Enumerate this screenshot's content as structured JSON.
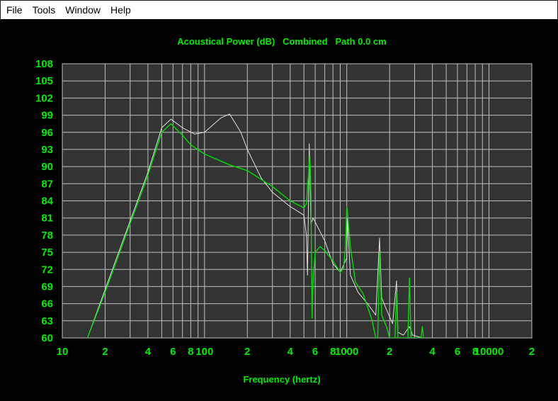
{
  "menu": {
    "items": [
      "File",
      "Tools",
      "Window",
      "Help"
    ]
  },
  "colors": {
    "background": "#000000",
    "plot_background": "#333333",
    "grid": "#bfbfbf",
    "text": "#00ee00",
    "primary_trace": "#00dd00",
    "secondary_trace": "#e0e0e0"
  },
  "chart_data": {
    "type": "line",
    "title": "Acoustical Power (dB)   Combined   Path 0.0 cm",
    "xlabel": "Frequency (hertz)",
    "ylabel": "",
    "x_scale": "log",
    "xlim": [
      10,
      20000
    ],
    "ylim": [
      60,
      108
    ],
    "grid": true,
    "y_ticks": [
      60,
      63,
      66,
      69,
      72,
      75,
      78,
      81,
      84,
      87,
      90,
      93,
      96,
      99,
      102,
      105,
      108
    ],
    "y_tick_labels": [
      "60",
      "63",
      "66",
      "69",
      "72",
      "75",
      "78",
      "81",
      "84",
      "87",
      "90",
      "93",
      "96",
      "99",
      "102",
      "105",
      "108"
    ],
    "x_ticks": [
      10,
      20,
      40,
      60,
      80,
      100,
      200,
      400,
      600,
      800,
      1000,
      2000,
      4000,
      6000,
      8000,
      10000,
      20000
    ],
    "x_tick_labels": [
      "10",
      "2",
      "4",
      "6",
      "8",
      "100",
      "2",
      "4",
      "6",
      "8",
      "1000",
      "2",
      "4",
      "6",
      "8",
      "10000",
      "2"
    ],
    "series": [
      {
        "color": "#00dd00",
        "points": [
          [
            15,
            60
          ],
          [
            20,
            68
          ],
          [
            30,
            80
          ],
          [
            40,
            88.5
          ],
          [
            50,
            96
          ],
          [
            58,
            97.5
          ],
          [
            70,
            95.5
          ],
          [
            80,
            93.8
          ],
          [
            100,
            92.2
          ],
          [
            150,
            90.3
          ],
          [
            200,
            89.3
          ],
          [
            300,
            86.5
          ],
          [
            400,
            84
          ],
          [
            500,
            82.8
          ],
          [
            520,
            83.5
          ],
          [
            540,
            89
          ],
          [
            550,
            92
          ],
          [
            560,
            85
          ],
          [
            570,
            63.5
          ],
          [
            580,
            70
          ],
          [
            600,
            75
          ],
          [
            650,
            76
          ],
          [
            700,
            75.3
          ],
          [
            800,
            73.5
          ],
          [
            900,
            71.5
          ],
          [
            950,
            72.2
          ],
          [
            980,
            76
          ],
          [
            1000,
            83
          ],
          [
            1020,
            81
          ],
          [
            1060,
            76
          ],
          [
            1150,
            69.8
          ],
          [
            1300,
            67.8
          ],
          [
            1500,
            63.2
          ],
          [
            1600,
            60
          ],
          [
            1650,
            60
          ],
          [
            1700,
            75
          ],
          [
            1760,
            64
          ],
          [
            1900,
            62
          ],
          [
            2000,
            60
          ],
          [
            2180,
            60
          ],
          [
            2240,
            68
          ],
          [
            2290,
            60
          ],
          [
            2690,
            60
          ],
          [
            2760,
            70.5
          ],
          [
            2830,
            60
          ],
          [
            3330,
            60
          ],
          [
            3400,
            62
          ],
          [
            3470,
            60
          ]
        ]
      },
      {
        "color": "#e0e0e0",
        "points": [
          [
            15,
            60
          ],
          [
            20,
            68.5
          ],
          [
            30,
            80.5
          ],
          [
            40,
            89
          ],
          [
            50,
            96.8
          ],
          [
            58,
            98.3
          ],
          [
            70,
            96.8
          ],
          [
            85,
            95.7
          ],
          [
            100,
            96
          ],
          [
            130,
            98.5
          ],
          [
            150,
            99.2
          ],
          [
            180,
            96
          ],
          [
            200,
            93
          ],
          [
            250,
            88
          ],
          [
            300,
            85.5
          ],
          [
            400,
            83
          ],
          [
            500,
            81.5
          ],
          [
            520,
            78
          ],
          [
            530,
            71
          ],
          [
            545,
            94
          ],
          [
            560,
            80
          ],
          [
            580,
            81
          ],
          [
            700,
            77
          ],
          [
            800,
            73
          ],
          [
            900,
            71.5
          ],
          [
            1000,
            74
          ],
          [
            1010,
            81
          ],
          [
            1060,
            71
          ],
          [
            1200,
            68
          ],
          [
            1400,
            66
          ],
          [
            1600,
            64
          ],
          [
            1700,
            77.5
          ],
          [
            1760,
            67
          ],
          [
            1900,
            65
          ],
          [
            2100,
            62.5
          ],
          [
            2240,
            70
          ],
          [
            2290,
            61
          ],
          [
            2500,
            60.5
          ],
          [
            2760,
            62
          ],
          [
            2900,
            60.5
          ],
          [
            3400,
            60
          ]
        ]
      }
    ]
  }
}
